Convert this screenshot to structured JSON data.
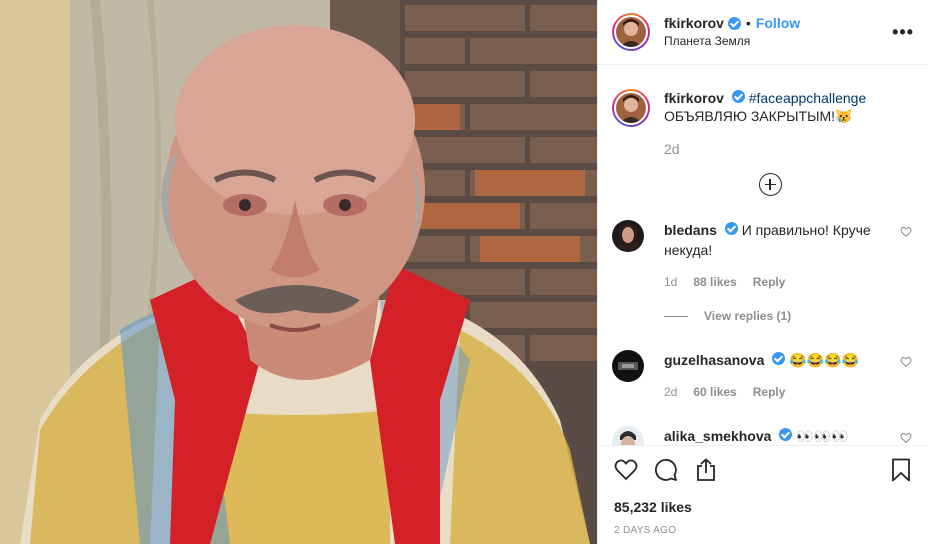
{
  "post": {
    "author": "fkirkorov",
    "follow_label": "Follow",
    "separator": "•",
    "location": "Планета Земля",
    "more_icon": "more-options-icon"
  },
  "caption": {
    "author": "fkirkorov",
    "hashtag": "#faceappchallenge",
    "text": "ОБЪЯВЛЯЮ ЗАКРЫТЫМ!😿",
    "age": "2d"
  },
  "comments": [
    {
      "user": "bledans",
      "verified": true,
      "text": "И правильно! Круче некуда!",
      "age": "1d",
      "likes": "88 likes",
      "reply": "Reply",
      "view_replies": "View replies (1)"
    },
    {
      "user": "guzelhasanova",
      "verified": true,
      "text": "😂😂😂😂",
      "age": "2d",
      "likes": "60 likes",
      "reply": "Reply"
    },
    {
      "user": "alika_smekhova",
      "verified": true,
      "text": "👀👀👀"
    }
  ],
  "engagement": {
    "likes": "85,232 likes",
    "posted": "2 DAYS AGO"
  },
  "colors": {
    "accent": "#3897f0",
    "hashtag": "#00376b",
    "muted": "#8e8e8e",
    "text": "#262626"
  }
}
